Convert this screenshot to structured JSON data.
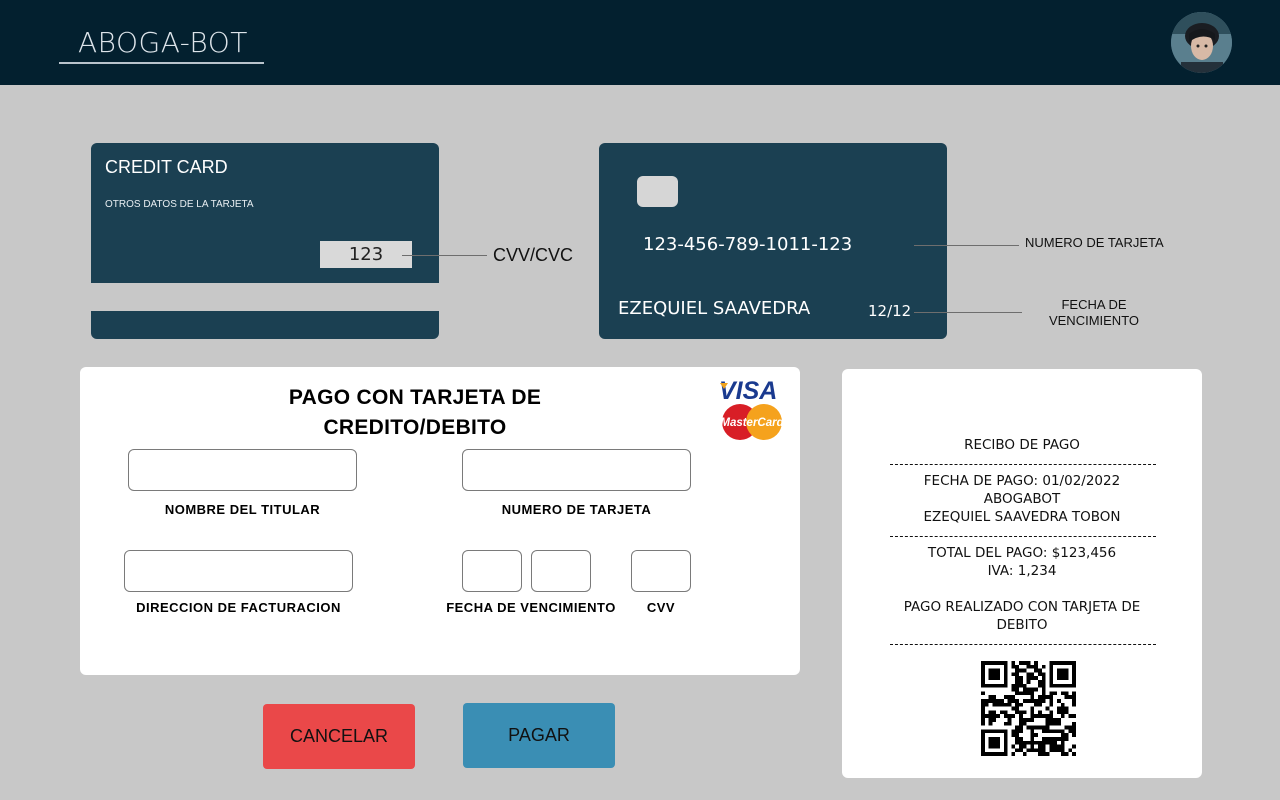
{
  "header": {
    "brand": "ABOGA-BOT",
    "avatar_icon": "user-avatar"
  },
  "card_back": {
    "title": "CREDIT CARD",
    "subtitle": "OTROS DATOS DE LA TARJETA",
    "cvv": "123",
    "cvv_annotation": "CVV/CVC"
  },
  "card_front": {
    "number": "123-456-789-1011-123",
    "holder": "EZEQUIEL SAAVEDRA",
    "expiry": "12/12",
    "number_annotation": "NUMERO DE TARJETA",
    "expiry_annotation_1": "FECHA DE",
    "expiry_annotation_2": "VENCIMIENTO"
  },
  "form": {
    "title_line1": "PAGO CON TARJETA DE",
    "title_line2": "CREDITO/DEBITO",
    "logos": [
      "VISA",
      "MasterCard"
    ],
    "labels": {
      "holder": "NOMBRE DEL TITULAR",
      "card_number": "NUMERO DE TARJETA",
      "billing_address": "DIRECCION DE FACTURACION",
      "expiry": "FECHA DE VENCIMIENTO",
      "cvv": "CVV"
    },
    "values": {
      "holder": "",
      "card_number": "",
      "billing_address": "",
      "expiry_month": "",
      "expiry_year": "",
      "cvv": ""
    }
  },
  "buttons": {
    "cancel": "CANCELAR",
    "pay": "PAGAR"
  },
  "receipt": {
    "title": "RECIBO DE PAGO",
    "date": "FECHA DE PAGO: 01/02/2022",
    "company": "ABOGABOT",
    "customer": "EZEQUIEL SAAVEDRA TOBON",
    "total": "TOTAL DEL PAGO: $123,456",
    "iva": "IVA: 1,234",
    "method_line1": "PAGO REALIZADO CON TARJETA DE",
    "method_line2": "DEBITO",
    "qr_icon": "qr-code"
  },
  "colors": {
    "header_bg": "#03202f",
    "page_bg": "#c8c8c8",
    "card_bg": "#1b4052",
    "cancel": "#ea4849",
    "pay": "#3a8eb4"
  }
}
